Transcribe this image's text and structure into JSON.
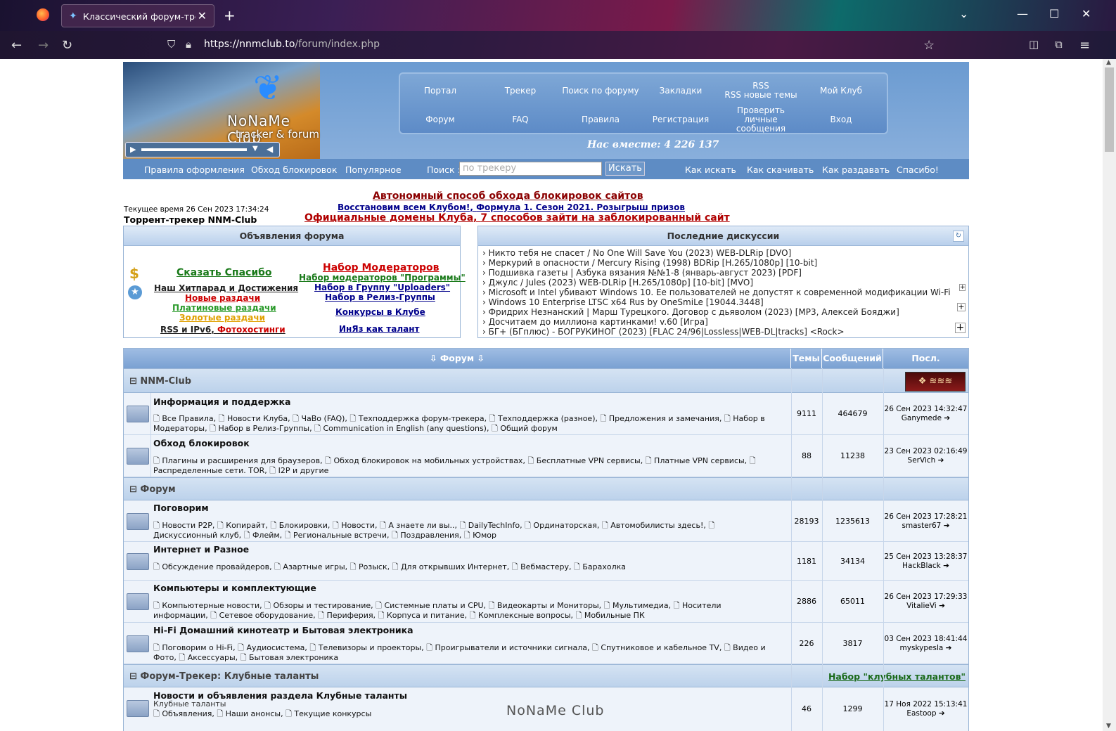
{
  "browser": {
    "tab_title": "Классический форум-трекер",
    "url_host": "https://nnmclub.to",
    "url_path": "/forum/index.php"
  },
  "logo": {
    "name": "NoNaMe Club",
    "tag": "tracker & forum"
  },
  "nav": [
    "Портал",
    "Трекер",
    "Поиск по форуму",
    "Закладки",
    "RSS\nRSS новые темы",
    "Мой Клуб",
    "Форум",
    "FAQ",
    "Правила",
    "Регистрация",
    "Проверить личные сообщения",
    "Вход"
  ],
  "together": "Нас вместе: 4 226 137",
  "subnav": {
    "rules": "Правила оформления",
    "bypass": "Обход блокировок",
    "popular": "Популярное",
    "search_label": "Поиск :",
    "search_placeholder": "по трекеру",
    "search_btn": "Искать",
    "how_search": "Как искать",
    "how_download": "Как скачивать",
    "how_seed": "Как раздавать",
    "thanks": "Спасибо!"
  },
  "announce": {
    "a1": "Автономный способ обхода блокировок сайтов",
    "a2a": "Восстановим всем Клубом!",
    "a2b": "Формула 1. Сезон 2021. Розыгрыш призов",
    "a3a": "Официальные домены Клуба",
    "a3b": "7 способов зайти на заблокированный сайт"
  },
  "time": "Текущее время 26 Сен 2023 17:34:24",
  "tracker_name": "Торрент-трекер NNM-Club",
  "forum_ads": {
    "title": "Объявления форума",
    "say_thanks": "Сказать Спасибо",
    "hitparade": "Наш Хитпарад и Достижения",
    "new": "Новые раздачи",
    "platinum": "Платиновые раздачи",
    "gold": "Золотые раздачи",
    "rss": "RSS и IPv6",
    "photo": "Фотохостинги",
    "mods": "Набор Модераторов",
    "mods_prog": "Набор модераторов \"Программы\"",
    "uploaders": "Набор в Группу \"Uploaders\"",
    "release": "Набор в Релиз-Группы",
    "contests": "Конкурсы в Клубе",
    "inyaz": "ИнЯз как талант"
  },
  "discussions": {
    "title": "Последние дискуссии",
    "items": [
      "Никто тебя не спасет / No One Will Save You (2023) WEB-DLRip [DVO]",
      "Меркурий в опасности / Mercury Rising (1998) BDRip [H.265/1080p] [10-bit]",
      "Подшивка газеты | Азбука вязания №№1-8 (январь-август 2023) [PDF]",
      "Джулс / Jules (2023) WEB-DLRip [H.265/1080p] [10-bit] [MVO]",
      "Microsoft и Intel убивают Windows 10. Ее пользователей не допустят к современной модификации Wi-Fi",
      "Windows 10 Enterprise LTSC x64 Rus by OneSmiLe [19044.3448]",
      "Фридрих Незнанский | Марш Турецкого. Договор с дьяволом (2023) [MP3, Алексей Бояджи]",
      "Досчитаем до миллиона картинками! v.60 [Игра]",
      "БГ+ (БГплюс) - БОГРУКИНОГ (2023) [FLAC 24/96|Lossless|WEB-DL|tracks] <Rock>"
    ]
  },
  "table": {
    "h_forum": "Форум",
    "h_topics": "Темы",
    "h_posts": "Сообщений",
    "h_last": "Посл. сообщение",
    "cat1": "NNM-Club",
    "cat2": "Форум",
    "cat3": "Форум-Трекер: Клубные таланты",
    "cat3_link": "Набор \"клубных талантов\"",
    "rows": [
      {
        "title": "Информация и поддержка",
        "subs": "Все Правила, Новости Клуба, ЧаВо (FAQ), Техподдержка форум-трекера, Техподдержка (разное), Предложения и замечания, Набор в Модераторы, Набор в Релиз-Группы, Communication in English (any questions), Общий форум",
        "topics": "9111",
        "posts": "464679",
        "date": "26 Сен 2023 14:32:47",
        "user": "Ganymede"
      },
      {
        "title": "Обход блокировок",
        "subs": "Плагины и расширения для браузеров, Обход блокировок на мобильных устройствах, Бесплатные VPN сервисы, Платные VPN сервисы, Распределенные сети. TOR, I2P и другие",
        "topics": "88",
        "posts": "11238",
        "date": "23 Сен 2023 02:16:49",
        "user": "SerVich"
      },
      {
        "title": "Поговорим",
        "subs": "Новости P2P, Копирайт, Блокировки, Новости, А знаете ли вы.., DailyTechInfo, Ординаторская, Автомобилисты здесь!, Дискуссионный клуб, Флейм, Региональные встречи, Поздравления, Юмор",
        "topics": "28193",
        "posts": "1235613",
        "date": "26 Сен 2023 17:28:21",
        "user": "smaster67"
      },
      {
        "title": "Интернет и Разное",
        "subs": "Обсуждение провайдеров, Азартные игры, Розыск, Для открывших Интернет, Вебмастеру, Барахолка",
        "topics": "1181",
        "posts": "34134",
        "date": "25 Сен 2023 13:28:37",
        "user": "HackBlack"
      },
      {
        "title": "Компьютеры и комплектующие",
        "subs": "Компьютерные новости, Обзоры и тестирование, Системные платы и CPU, Видеокарты и Мониторы, Мультимедиа, Носители информации, Сетевое оборудование, Периферия, Корпуса и питание, Комплексные вопросы, Мобильные ПК",
        "topics": "2886",
        "posts": "65011",
        "date": "26 Сен 2023 17:29:33",
        "user": "VitalieVi"
      },
      {
        "title": "Hi-Fi Домашний кинотеатр и Бытовая электроника",
        "subs": "Поговорим о Hi-Fi, Аудиосистема, Телевизоры и проекторы, Проигрыватели и источники сигнала, Спутниковое и кабельное TV, Видео и Фото, Аксессуары, Бытовая электроника",
        "topics": "226",
        "posts": "3817",
        "date": "03 Сен 2023 18:41:44",
        "user": "myskypesla"
      },
      {
        "title": "Новости и объявления раздела Клубные таланты",
        "note": "Клубные таланты",
        "subs": "Объявления, Наши анонсы, Текущие конкурсы",
        "topics": "46",
        "posts": "1299",
        "date": "17 Ноя 2022 15:13:41",
        "user": "Eastoop"
      }
    ]
  },
  "watermark": "NoNaMe Club"
}
